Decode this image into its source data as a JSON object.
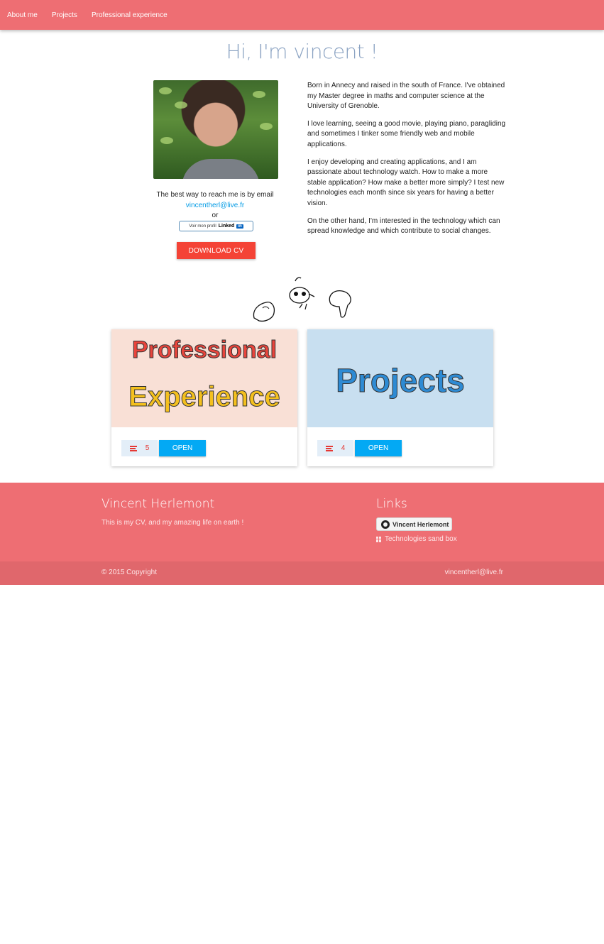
{
  "nav": {
    "items": [
      "About me",
      "Projects",
      "Professional experience"
    ]
  },
  "hero": {
    "greeting": "Hi, I'm vincent !"
  },
  "contact": {
    "reach_text": "The best way to reach me is by email",
    "email": "vincentherl@live.fr",
    "or_text": "or",
    "linkedin_prefix": "Voir mon profil",
    "linkedin_word": "Linked",
    "linkedin_in": "in",
    "download_label": "DOWNLOAD CV"
  },
  "bio": {
    "paragraphs": [
      "Born in Annecy and raised in the south of France. I've obtained my Master degree in maths and computer science at the University of Grenoble.",
      "I love learning, seeing a good movie, playing piano, paragliding and sometimes I tinker some friendly web and mobile applications.",
      "I enjoy developing and creating applications, and I am passionate about technology watch. How to make a more stable application? How make a better more simply? I test new technologies each month since six years for having a better vision.",
      "On the other hand, I'm interested in the technology which can spread knowledge and which contribute to social changes."
    ]
  },
  "cards": [
    {
      "banner_line1": "Professional",
      "banner_line2": "Experience",
      "banner_bg": "#f9e0d6",
      "count": "5",
      "open_label": "OPEN"
    },
    {
      "banner_line1": "Projects",
      "banner_bg": "#c8dff0",
      "count": "4",
      "open_label": "OPEN"
    }
  ],
  "footer": {
    "name": "Vincent Herlemont",
    "tagline": "This is my CV, and my amazing life on earth !",
    "links_title": "Links",
    "github_label": "Vincent Herlemont",
    "sandbox_label": "Technologies sand box",
    "copyright": "© 2015 Copyright",
    "email": "vincentherl@live.fr"
  },
  "colors": {
    "brand": "#ee6e73",
    "accent_red": "#f44336",
    "accent_blue": "#03a9f4"
  }
}
